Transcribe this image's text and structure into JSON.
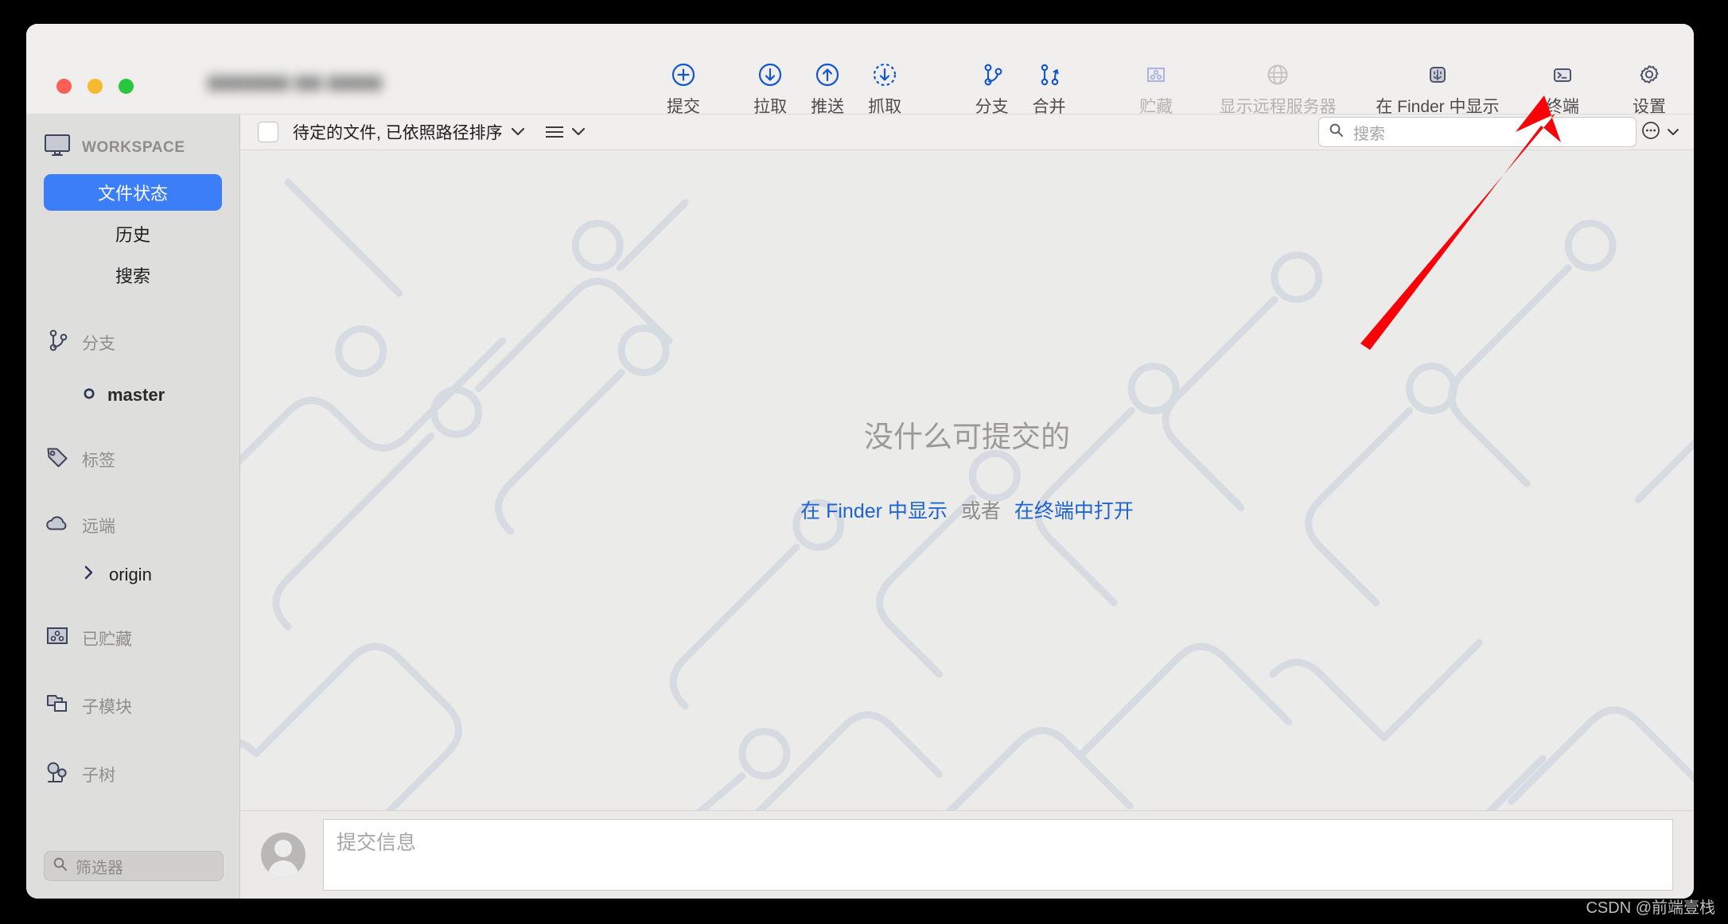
{
  "window": {
    "title": "",
    "traffic_lights": [
      "close",
      "minimize",
      "maximize"
    ]
  },
  "toolbar": {
    "items": [
      {
        "label": "提交",
        "icon": "commit-plus-circle-icon",
        "enabled": true
      },
      {
        "label": "拉取",
        "icon": "pull-down-arrow-circle-icon",
        "enabled": true
      },
      {
        "label": "推送",
        "icon": "push-up-arrow-circle-icon",
        "enabled": true
      },
      {
        "label": "抓取",
        "icon": "fetch-dashed-circle-icon",
        "enabled": true
      },
      {
        "label": "分支",
        "icon": "branch-icon",
        "enabled": true
      },
      {
        "label": "合并",
        "icon": "merge-icon",
        "enabled": true
      },
      {
        "label": "贮藏",
        "icon": "stash-box-icon",
        "enabled": false
      },
      {
        "label": "显示远程服务器",
        "icon": "globe-icon",
        "enabled": false
      },
      {
        "label": "在 Finder 中显示",
        "icon": "finder-icon",
        "enabled": true
      },
      {
        "label": "终端",
        "icon": "terminal-icon",
        "enabled": true
      },
      {
        "label": "设置",
        "icon": "gear-icon",
        "enabled": true
      }
    ]
  },
  "sidebar": {
    "workspace": {
      "icon": "monitor-icon",
      "label": "WORKSPACE",
      "items": [
        {
          "label": "文件状态",
          "active": true
        },
        {
          "label": "历史",
          "active": false
        },
        {
          "label": "搜索",
          "active": false
        }
      ]
    },
    "branches": {
      "icon": "branch-icon",
      "label": "分支",
      "items": [
        {
          "label": "master",
          "icon": "branch-node-icon"
        }
      ]
    },
    "tags": {
      "icon": "tag-icon",
      "label": "标签",
      "items": []
    },
    "remotes": {
      "icon": "cloud-icon",
      "label": "远端",
      "items": [
        {
          "label": "origin",
          "icon": "chevron-right-icon"
        }
      ]
    },
    "stashes": {
      "icon": "stash-box-icon",
      "label": "已贮藏"
    },
    "submodules": {
      "icon": "submodule-icon",
      "label": "子模块"
    },
    "subtrees": {
      "icon": "subtree-icon",
      "label": "子树"
    },
    "filter": {
      "icon": "search-icon",
      "placeholder": "筛选器",
      "value": ""
    }
  },
  "file_bar": {
    "checkbox_checked": false,
    "label": "待定的文件, 已依照路径排序",
    "dropdown_icon": "chevron-down-icon",
    "list_view_icon": "list-lines-icon",
    "list_view_chevron": "chevron-down-icon",
    "search": {
      "icon": "search-icon",
      "placeholder": "搜索",
      "value": ""
    },
    "more": {
      "icon": "ellipsis-circle-icon",
      "chevron": "chevron-down-icon"
    }
  },
  "empty_state": {
    "title": "没什么可提交的",
    "link_finder": "在 Finder 中显示",
    "conjunction": "或者",
    "link_terminal": "在终端中打开"
  },
  "commit_bar": {
    "avatar": "user-avatar",
    "message_placeholder": "提交信息",
    "message_value": ""
  },
  "annotation": {
    "arrow": "red-arrow-pointing-to-terminal-button",
    "color": "#fb0007"
  },
  "watermark": "CSDN @前端壹栈",
  "colors": {
    "accent_blue": "#1355cc",
    "selection_blue": "#3b7ef7",
    "link_blue": "#1e63d0",
    "icon_slate": "#4d5468",
    "icon_disabled": "#b9bccb",
    "window_bg": "#eeedec",
    "sidebar_bg": "#dededd",
    "canvas_bg": "#ebebea",
    "pattern_line": "#d6dae1"
  }
}
